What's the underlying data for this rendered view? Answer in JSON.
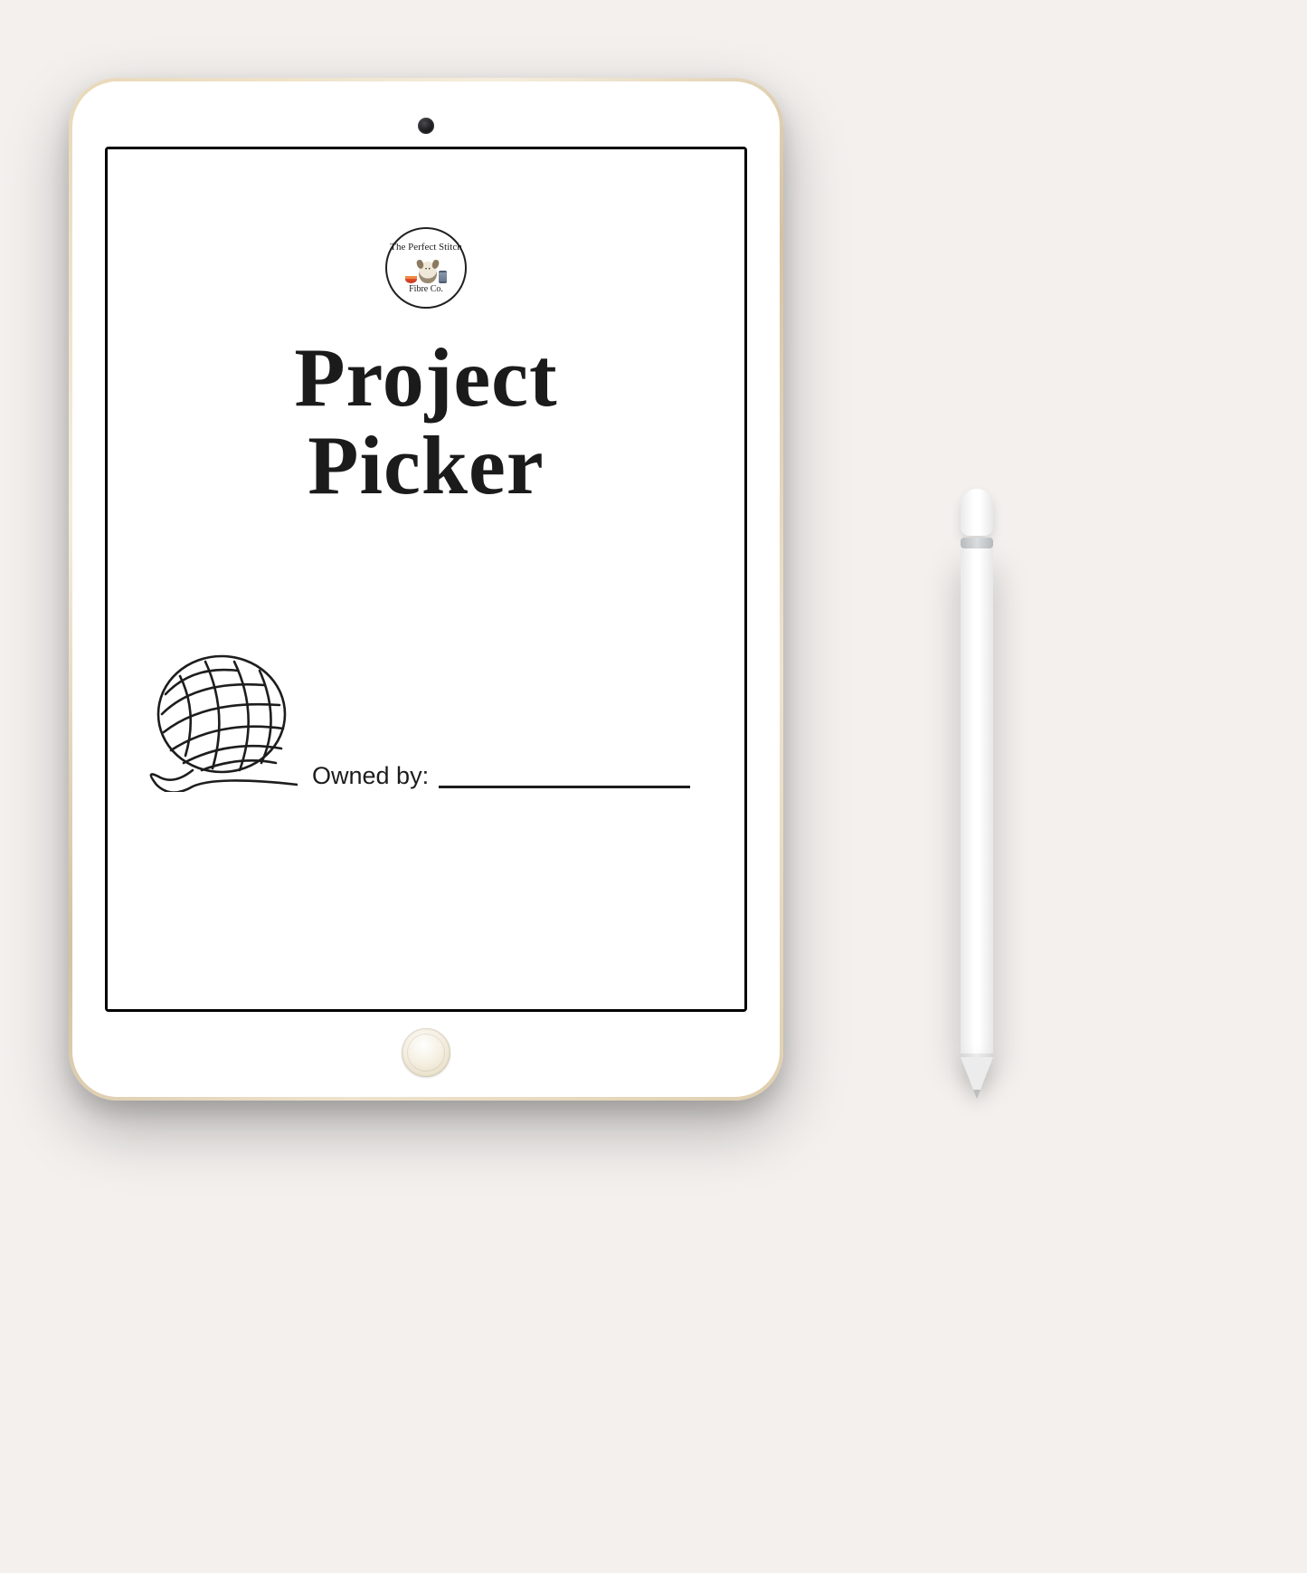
{
  "logo": {
    "top_text": "The Perfect Stitch",
    "bottom_text": "Fibre Co."
  },
  "title": {
    "line1": "Project",
    "line2": "Picker"
  },
  "owner": {
    "label": "Owned by:",
    "value": ""
  }
}
